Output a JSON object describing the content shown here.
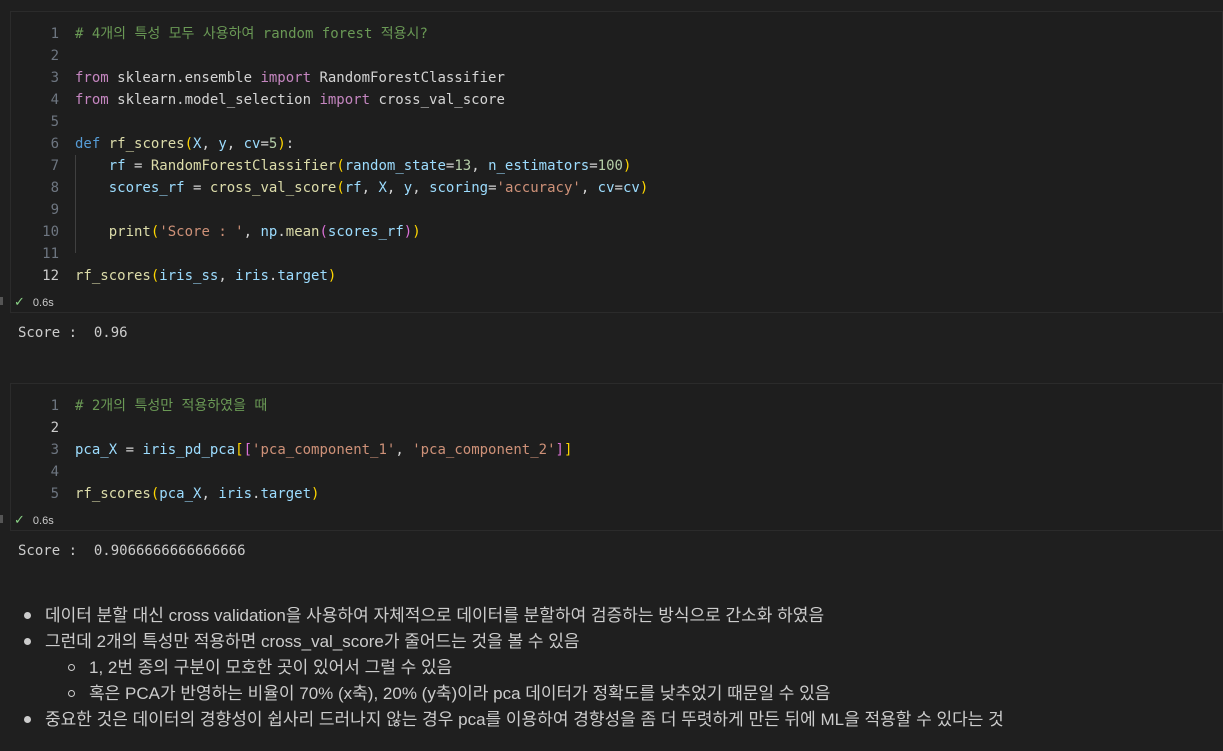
{
  "cells": [
    {
      "lines": [
        {
          "n": "1",
          "tokens": [
            [
              "comment",
              "# 4개의 특성 모두 사용하여 random forest 적용시?"
            ]
          ]
        },
        {
          "n": "2",
          "tokens": []
        },
        {
          "n": "3",
          "tokens": [
            [
              "kw",
              "from"
            ],
            [
              "plain",
              " sklearn.ensemble "
            ],
            [
              "kw",
              "import"
            ],
            [
              "plain",
              " RandomForestClassifier"
            ]
          ]
        },
        {
          "n": "4",
          "tokens": [
            [
              "kw",
              "from"
            ],
            [
              "plain",
              " sklearn.model_selection "
            ],
            [
              "kw",
              "import"
            ],
            [
              "plain",
              " cross_val_score"
            ]
          ]
        },
        {
          "n": "5",
          "tokens": []
        },
        {
          "n": "6",
          "tokens": [
            [
              "def",
              "def"
            ],
            [
              "plain",
              " "
            ],
            [
              "fn",
              "rf_scores"
            ],
            [
              "brk1",
              "("
            ],
            [
              "var",
              "X"
            ],
            [
              "plain",
              ", "
            ],
            [
              "var",
              "y"
            ],
            [
              "plain",
              ", "
            ],
            [
              "var",
              "cv"
            ],
            [
              "plain",
              "="
            ],
            [
              "num",
              "5"
            ],
            [
              "brk1",
              ")"
            ],
            [
              "plain",
              ":"
            ]
          ]
        },
        {
          "n": "7",
          "tokens": [
            [
              "plain",
              "    "
            ],
            [
              "var",
              "rf"
            ],
            [
              "plain",
              " = "
            ],
            [
              "fn",
              "RandomForestClassifier"
            ],
            [
              "brk1",
              "("
            ],
            [
              "var",
              "random_state"
            ],
            [
              "plain",
              "="
            ],
            [
              "num",
              "13"
            ],
            [
              "plain",
              ", "
            ],
            [
              "var",
              "n_estimators"
            ],
            [
              "plain",
              "="
            ],
            [
              "num",
              "100"
            ],
            [
              "brk1",
              ")"
            ]
          ]
        },
        {
          "n": "8",
          "tokens": [
            [
              "plain",
              "    "
            ],
            [
              "var",
              "scores_rf"
            ],
            [
              "plain",
              " = "
            ],
            [
              "fn",
              "cross_val_score"
            ],
            [
              "brk1",
              "("
            ],
            [
              "var",
              "rf"
            ],
            [
              "plain",
              ", "
            ],
            [
              "var",
              "X"
            ],
            [
              "plain",
              ", "
            ],
            [
              "var",
              "y"
            ],
            [
              "plain",
              ", "
            ],
            [
              "var",
              "scoring"
            ],
            [
              "plain",
              "="
            ],
            [
              "str",
              "'accuracy'"
            ],
            [
              "plain",
              ", "
            ],
            [
              "var",
              "cv"
            ],
            [
              "plain",
              "="
            ],
            [
              "var",
              "cv"
            ],
            [
              "brk1",
              ")"
            ]
          ]
        },
        {
          "n": "9",
          "tokens": []
        },
        {
          "n": "10",
          "tokens": [
            [
              "plain",
              "    "
            ],
            [
              "fn",
              "print"
            ],
            [
              "brk1",
              "("
            ],
            [
              "str",
              "'Score : '"
            ],
            [
              "plain",
              ", "
            ],
            [
              "var",
              "np"
            ],
            [
              "plain",
              "."
            ],
            [
              "fn",
              "mean"
            ],
            [
              "brk2",
              "("
            ],
            [
              "var",
              "scores_rf"
            ],
            [
              "brk2",
              ")"
            ],
            [
              "brk1",
              ")"
            ]
          ]
        },
        {
          "n": "11",
          "tokens": []
        },
        {
          "n": "12",
          "tokens": [
            [
              "fn",
              "rf_scores"
            ],
            [
              "brk1",
              "("
            ],
            [
              "var",
              "iris_ss"
            ],
            [
              "plain",
              ", "
            ],
            [
              "var",
              "iris"
            ],
            [
              "plain",
              "."
            ],
            [
              "var",
              "target"
            ],
            [
              "brk1",
              ")"
            ]
          ],
          "active": true
        }
      ],
      "status_time": "0.6s",
      "output": "Score :  0.96"
    },
    {
      "lines": [
        {
          "n": "1",
          "tokens": [
            [
              "comment",
              "# 2개의 특성만 적용하였을 때"
            ]
          ]
        },
        {
          "n": "2",
          "tokens": [],
          "active": true
        },
        {
          "n": "3",
          "tokens": [
            [
              "var",
              "pca_X"
            ],
            [
              "plain",
              " = "
            ],
            [
              "var",
              "iris_pd_pca"
            ],
            [
              "brk1",
              "["
            ],
            [
              "brk2",
              "["
            ],
            [
              "str",
              "'pca_component_1'"
            ],
            [
              "plain",
              ", "
            ],
            [
              "str",
              "'pca_component_2'"
            ],
            [
              "brk2",
              "]"
            ],
            [
              "brk1",
              "]"
            ]
          ]
        },
        {
          "n": "4",
          "tokens": []
        },
        {
          "n": "5",
          "tokens": [
            [
              "fn",
              "rf_scores"
            ],
            [
              "brk1",
              "("
            ],
            [
              "var",
              "pca_X"
            ],
            [
              "plain",
              ", "
            ],
            [
              "var",
              "iris"
            ],
            [
              "plain",
              "."
            ],
            [
              "var",
              "target"
            ],
            [
              "brk1",
              ")"
            ]
          ]
        }
      ],
      "status_time": "0.6s",
      "output": "Score :  0.9066666666666666"
    }
  ],
  "markdown": {
    "bullets": [
      {
        "level": 1,
        "text": "데이터 분할 대신 cross validation을 사용하여 자체적으로 데이터를 분할하여 검증하는 방식으로 간소화 하였음"
      },
      {
        "level": 1,
        "text": "그런데 2개의 특성만 적용하면 cross_val_score가 줄어드는 것을 볼 수 있음"
      },
      {
        "level": 2,
        "text": "1, 2번 종의 구분이 모호한 곳이 있어서 그럴 수 있음"
      },
      {
        "level": 2,
        "text": "혹은 PCA가 반영하는 비율이 70% (x축), 20% (y축)이라 pca 데이터가 정확도를 낮추었기 때문일 수 있음"
      },
      {
        "level": 1,
        "text": "중요한 것은 데이터의 경향성이 쉽사리 드러나지 않는 경우 pca를 이용하여 경향성을 좀 더 뚜렷하게 만든 뒤에 ML을 적용할 수 있다는 것"
      }
    ]
  },
  "colors": {
    "background": "#1f1f1f",
    "comment": "#6a9955",
    "keyword": "#c586c0",
    "function": "#dcdcaa",
    "variable": "#9cdcfe",
    "string": "#ce9178",
    "number": "#b5cea8",
    "success": "#89d185"
  },
  "icons": {
    "status": "check-icon",
    "bullet_level1": "filled-dot-icon",
    "bullet_level2": "hollow-circle-icon"
  }
}
